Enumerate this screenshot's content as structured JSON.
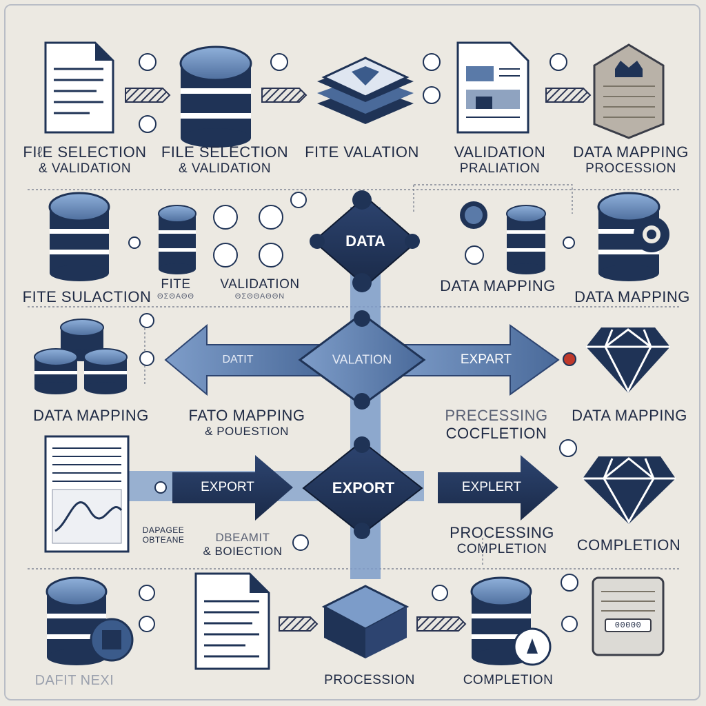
{
  "colors": {
    "background": "#ece9e2",
    "navy": "#1f3356",
    "steel_blue": "#5a7aa8",
    "light_blue": "#7c9cc9",
    "text": "#1f2a44",
    "accent_red": "#c0392b"
  },
  "row1": {
    "labels": [
      {
        "line1": "FIℓE SELECTION",
        "line2": "& VALIDATION"
      },
      {
        "line1": "FILE SELECTION",
        "line2": "& VALIDATION"
      },
      {
        "line1": "FITE VALATION",
        "line2": ""
      },
      {
        "line1": "VALIDATION",
        "line2": "PRALIATION"
      },
      {
        "line1": "DATA MAPPING",
        "line2": "PROCESSION"
      }
    ]
  },
  "row2": {
    "labels": [
      "FITE SULACTION",
      "FITE",
      "VALIDATION",
      "DATA MAPPING",
      "DATA MAPPING"
    ],
    "sublabels": [
      "ΘΣΘΑΘΘ",
      "ΘΣΘΘΑΘΘΝ"
    ]
  },
  "center": {
    "diamond_top": "DATA",
    "diamond_mid": "VALATION",
    "diamond_bottom": "EXPORT"
  },
  "row3": {
    "arrow_left_text": "DATIT",
    "arrow_right_text": "EXPART",
    "labels": [
      {
        "line1": "DATA MAPPING",
        "line2": ""
      },
      {
        "line1": "FATO MAPPING",
        "line2": "& POUESTION"
      },
      {
        "line1": "PRECESSING",
        "line2": "COCFLETION"
      },
      {
        "line1": "DATA MAPPING",
        "line2": ""
      }
    ]
  },
  "row4": {
    "arrow_left_text": "EXPORT",
    "arrow_right_text": "EXPLERT",
    "labels": [
      {
        "line1": "DAPAGEE",
        "line2": "OBTEANE"
      },
      {
        "line1": "DBEAMIT",
        "line2": "& BOIECTION"
      },
      {
        "line1": "PROCESSING",
        "line2": "COMPLETION"
      },
      {
        "line1": "COMPLETION",
        "line2": ""
      }
    ]
  },
  "row5": {
    "labels": [
      "DAFIT NEXI",
      "PROCESSION",
      "COMPLETION"
    ],
    "server_code": "00000"
  },
  "icons": [
    "document-icon",
    "database-icon",
    "layers-icon",
    "report-icon",
    "crown-shield-icon",
    "gear-icon",
    "stack-icon",
    "diamond-gem-icon",
    "spreadsheet-icon",
    "box-icon",
    "server-icon",
    "lock-icon",
    "link-chain-icon"
  ]
}
